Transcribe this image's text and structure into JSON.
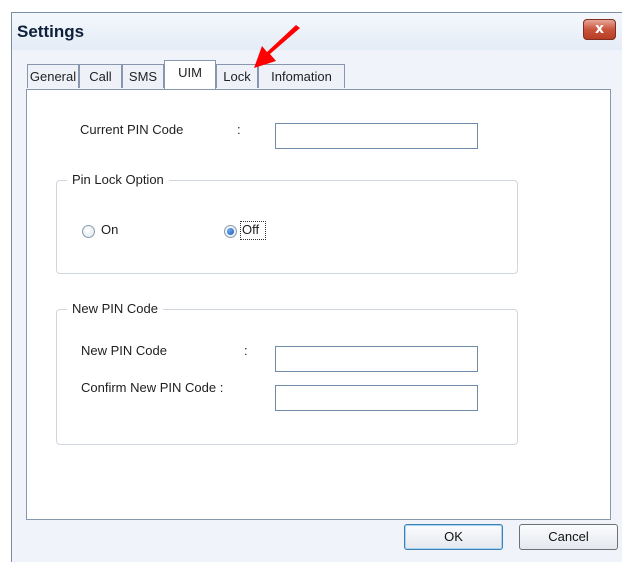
{
  "window": {
    "title": "Settings",
    "close_label": "x"
  },
  "tabs": [
    {
      "label": "General",
      "active": false
    },
    {
      "label": "Call",
      "active": false
    },
    {
      "label": "SMS",
      "active": false
    },
    {
      "label": "UIM",
      "active": true
    },
    {
      "label": "Lock",
      "active": false
    },
    {
      "label": "Infomation",
      "active": false
    }
  ],
  "uim": {
    "current_pin_label": "Current PIN Code",
    "current_pin_colon": ":",
    "current_pin_value": "",
    "pin_lock_group_title": "Pin Lock Option",
    "option_on_label": "On",
    "option_off_label": "Off",
    "selected_option": "Off",
    "new_pin_group_title": "New PIN Code",
    "new_pin_label": "New PIN Code",
    "new_pin_colon": ":",
    "new_pin_value": "",
    "confirm_pin_label": "Confirm New PIN Code :",
    "confirm_pin_value": ""
  },
  "buttons": {
    "ok_label": "OK",
    "cancel_label": "Cancel"
  },
  "annotation": {
    "icon": "red-arrow-icon",
    "color": "#ff0000"
  }
}
